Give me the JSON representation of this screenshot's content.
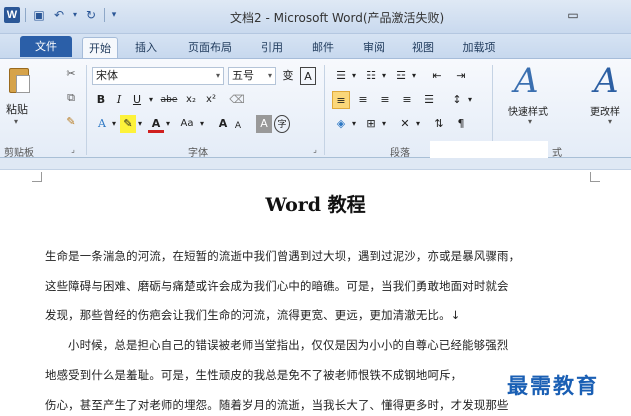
{
  "window": {
    "title": "文档2 - Microsoft Word(产品激活失败)",
    "minimize": "▭"
  },
  "tabs": [
    {
      "label": "文件"
    },
    {
      "label": "开始"
    },
    {
      "label": "插入"
    },
    {
      "label": "页面布局"
    },
    {
      "label": "引用"
    },
    {
      "label": "邮件"
    },
    {
      "label": "审阅"
    },
    {
      "label": "视图"
    },
    {
      "label": "加载项"
    }
  ],
  "ribbon": {
    "clipboard": {
      "paste_label": "粘贴",
      "group_label": "剪贴板"
    },
    "font": {
      "font_name": "宋体",
      "font_size": "五号",
      "bold": "B",
      "italic": "I",
      "underline": "U",
      "strike": "abe",
      "subscript": "x₂",
      "superscript": "x²",
      "grow": "A",
      "shrink": "A",
      "aa": "Aa",
      "group_label": "字体"
    },
    "paragraph": {
      "group_label": "段落"
    },
    "styles": {
      "quick_styles": "快速样式",
      "change_styles": "更改样",
      "group_label": "式"
    }
  },
  "document": {
    "title": "Word 教程",
    "lines": [
      "生命是一条湍急的河流，在短暂的流逝中我们曾遇到过大坝，遇到过泥沙，亦或是暴风骤雨，",
      "这些障碍与困难、磨砺与痛楚或许会成为我们心中的暗礁。可是，当我们勇敢地面对时就会",
      "发现，那些曾经的伤疤会让我们生命的河流，流得更宽、更远，更加清澈无比。↓",
      "小时候，总是担心自己的错误被老师当堂指出，仅仅是因为小小的自尊心已经能够强烈",
      "地感受到什么是羞耻。可是，生性顽皮的我总是免不了被老师恨铁不成钢地呵斥，",
      "伤心，甚至产生了对老师的埋怨。随着岁月的流逝，当我长大了、懂得更多时，才发现那些"
    ]
  },
  "watermark": "最需教育"
}
